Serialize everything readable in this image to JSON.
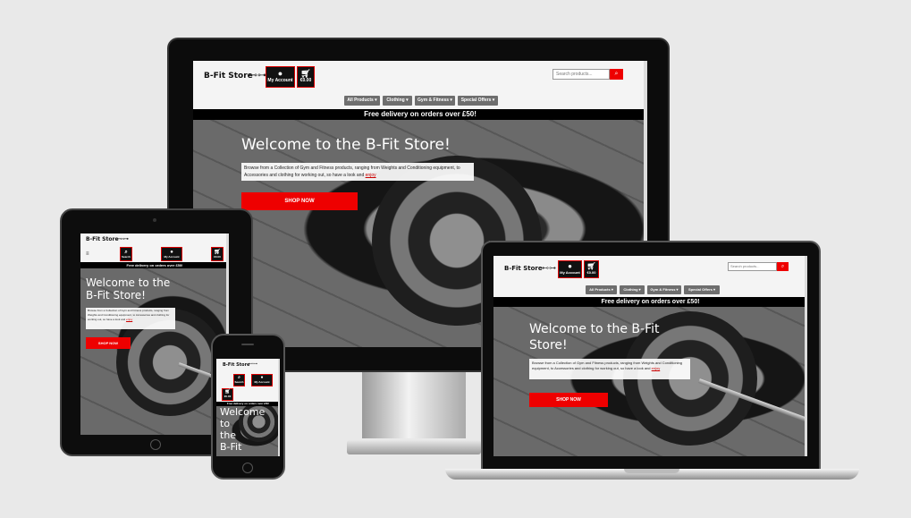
{
  "site": {
    "brand": "B-Fit Store",
    "brand_icon": "dumbbell-icon",
    "search_label": "Search",
    "search_placeholder": "Search products...",
    "account_label": "My Account",
    "cart_amount": "€0.00",
    "nav": [
      "All Products",
      "Clothing",
      "Gym & Fitness",
      "Special Offers"
    ],
    "banner": "Free delivery on orders over £50!",
    "hero_title": "Welcome to the B-Fit Store!",
    "hero_text": "Browse from a Collection of Gym and Fitness products, ranging from Weights and Conditioning equipment, to Accessories and clothing for working out, so have a look and",
    "hero_text_link": "enjoy",
    "shop_button": "SHOP NOW"
  },
  "phone": {
    "hero_title_lines": [
      "Welcome",
      "to",
      "the",
      "B-Fit"
    ]
  },
  "colors": {
    "accent": "#e00000",
    "header_bg": "#f4f4f4",
    "nav_button": "#6e6e6e",
    "banner_bg": "#000000",
    "page_bg": "#e9e9e9"
  }
}
